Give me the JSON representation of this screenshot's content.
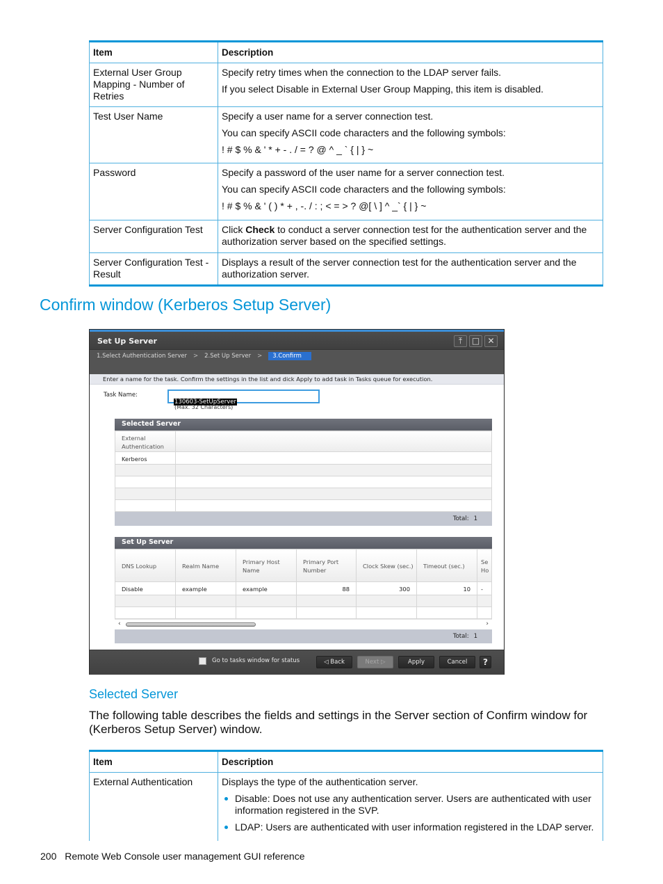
{
  "table1": {
    "headers": [
      "Item",
      "Description"
    ],
    "rows": [
      {
        "item": "External User Group Mapping - Number of Retries",
        "desc": [
          "Specify retry times when the connection to the LDAP server fails.",
          "If you select Disable in External User Group Mapping, this item is disabled."
        ]
      },
      {
        "item": "Test User Name",
        "desc": [
          "Specify a user name for a server connection test.",
          "You can specify ASCII code characters and the following symbols:",
          "! # $ % & ' * + - . / = ? @ ^ _ ` { | } ~"
        ]
      },
      {
        "item": "Password",
        "desc": [
          "Specify a password of the user name for a server connection test.",
          "You can specify ASCII code characters and the following symbols:",
          "! # $ % & ' ( ) * + , -. / : ; < = > ? @[ \\ ] ^ _` { | } ~"
        ]
      },
      {
        "item": "Server Configuration Test",
        "desc_pre": "Click ",
        "desc_bold": "Check",
        "desc_post": " to conduct a server connection test for the authentication server and the authorization server based on the specified settings."
      },
      {
        "item": "Server Configuration Test - Result",
        "desc": [
          "Displays a result of the server connection test for the authentication server and the authorization server."
        ]
      }
    ]
  },
  "section_heading": "Confirm window (Kerberos Setup Server)",
  "window": {
    "title": "Set Up Server",
    "title_buttons": [
      "pin",
      "maximize",
      "close"
    ],
    "title_button_glyphs": [
      "⤒",
      "□",
      "✕"
    ],
    "breadcrumbs": [
      "1.Select Authentication Server",
      "2.Set Up Server",
      "3.Confirm"
    ],
    "breadcrumb_separator": ">",
    "instruction": "Enter a name for the task. Confirm the settings in the list and dick Apply to add task in Tasks queue for execution.",
    "task_name_label": "Task Name:",
    "task_name_value": "130603-SetUpServer",
    "task_name_hint": "(Max. 32 Characters)",
    "selected_server": {
      "title": "Selected Server",
      "column": "External Authentication",
      "rows": [
        "Kerberos",
        "",
        "",
        "",
        ""
      ],
      "total_label": "Total:",
      "total": "1"
    },
    "setup_server": {
      "title": "Set Up Server",
      "columns": [
        "DNS Lookup",
        "Realm Name",
        "Primary Host Name",
        "Primary Port Number",
        "Clock Skew (sec.)",
        "Timeout (sec.)",
        "Se Ho"
      ],
      "rows": [
        [
          "Disable",
          "example",
          "example",
          "88",
          "300",
          "10",
          "-"
        ]
      ],
      "total_label": "Total:",
      "total": "1"
    },
    "footer": {
      "checkbox_label": "Go to tasks window for status",
      "checkbox_checked": false,
      "back": "◁ Back",
      "next": "Next ▷",
      "apply": "Apply",
      "cancel": "Cancel",
      "help": "?"
    }
  },
  "subheading": "Selected Server",
  "paragraph": "The following table describes the fields and settings in the Server section of Confirm window for (Kerberos Setup Server) window.",
  "table2": {
    "headers": [
      "Item",
      "Description"
    ],
    "rows": [
      {
        "item": "External Authentication",
        "desc": "Displays the type of the authentication server.",
        "bullets": [
          "Disable: Does not use any authentication server. Users are authenticated with user information registered in the SVP.",
          "LDAP: Users are authenticated with user information registered in the LDAP server."
        ]
      }
    ]
  },
  "footer": {
    "page_number": "200",
    "text": "Remote Web Console user management GUI reference"
  },
  "colors": {
    "accent": "#0596d8",
    "window_bg": "#545454",
    "breadcrumb_active": "#2a70d0"
  }
}
